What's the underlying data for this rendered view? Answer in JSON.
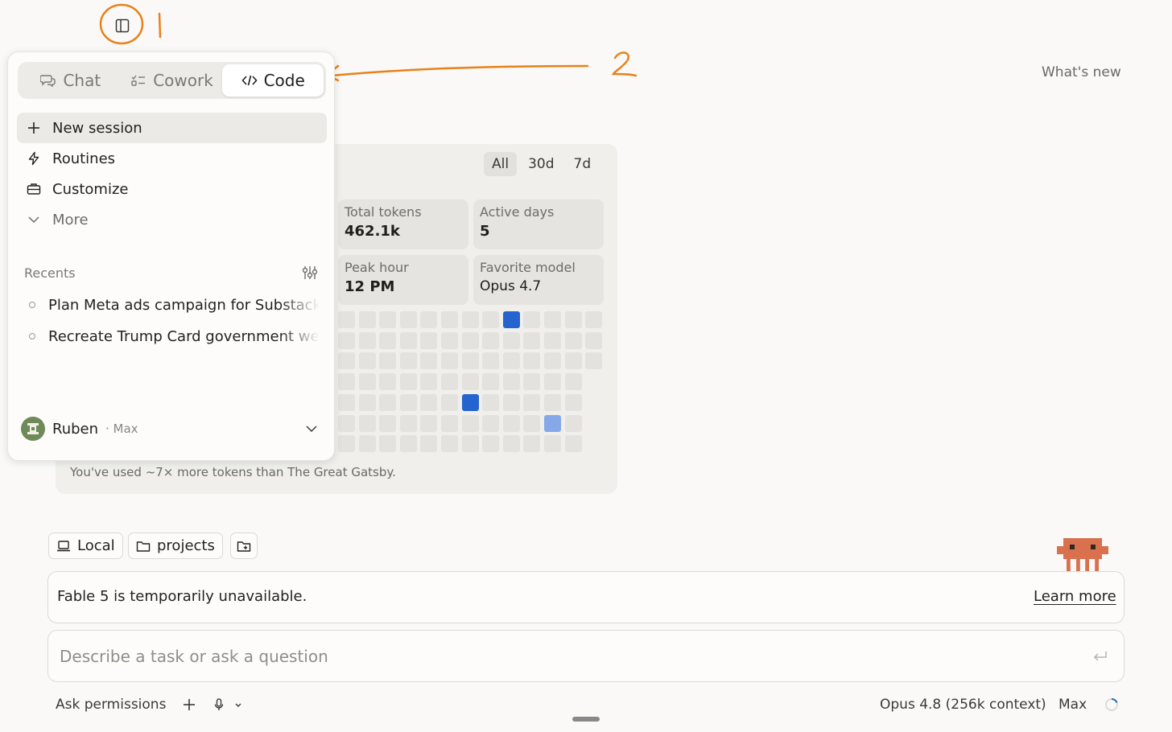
{
  "header": {
    "whats_new": "What's new"
  },
  "annotations": {
    "label_1": "1",
    "label_2": "2",
    "color": "#e8811a"
  },
  "panel": {
    "tabs": [
      {
        "label": "Chat",
        "icon": "chat-icon"
      },
      {
        "label": "Cowork",
        "icon": "checklist-icon"
      },
      {
        "label": "Code",
        "icon": "code-icon",
        "active": true
      }
    ],
    "menu": [
      {
        "label": "New session",
        "icon": "plus-icon"
      },
      {
        "label": "Routines",
        "icon": "lightning-icon"
      },
      {
        "label": "Customize",
        "icon": "briefcase-icon"
      },
      {
        "label": "More",
        "icon": "chevron-down-icon"
      }
    ],
    "recents_label": "Recents",
    "recents": [
      "Plan Meta ads campaign for Substack",
      "Recreate Trump Card government website"
    ],
    "user": {
      "name": "Ruben",
      "plan": "· Max"
    }
  },
  "stats": {
    "ranges": [
      "All",
      "30d",
      "7d"
    ],
    "active_range": "All",
    "cards": [
      {
        "label": "Total tokens",
        "value": "462.1k"
      },
      {
        "label": "Active days",
        "value": "5"
      },
      {
        "label": "Peak hour",
        "value": "12 PM"
      },
      {
        "label": "Favorite model",
        "value": "Opus 4.7"
      }
    ],
    "heatmap_highlights": [
      {
        "col": 8,
        "row": 0,
        "level": "high",
        "color": "#2563cf"
      },
      {
        "col": 6,
        "row": 4,
        "level": "high",
        "color": "#2563cf"
      },
      {
        "col": 10,
        "row": 5,
        "level": "medium",
        "color": "#86a8e8"
      }
    ],
    "footnote": "You've used ~7× more tokens than The Great Gatsby."
  },
  "workspace": {
    "local_label": "Local",
    "folder_label": "projects"
  },
  "notice": {
    "text": "Fable 5 is temporarily unavailable.",
    "link": "Learn more"
  },
  "prompt": {
    "placeholder": "Describe a task or ask a question"
  },
  "footer": {
    "permissions": "Ask permissions",
    "model": "Opus 4.8 (256k context)",
    "effort": "Max"
  },
  "colors": {
    "accent": "#2563cf",
    "mascot": "#d9714e",
    "annotation": "#e8811a"
  }
}
